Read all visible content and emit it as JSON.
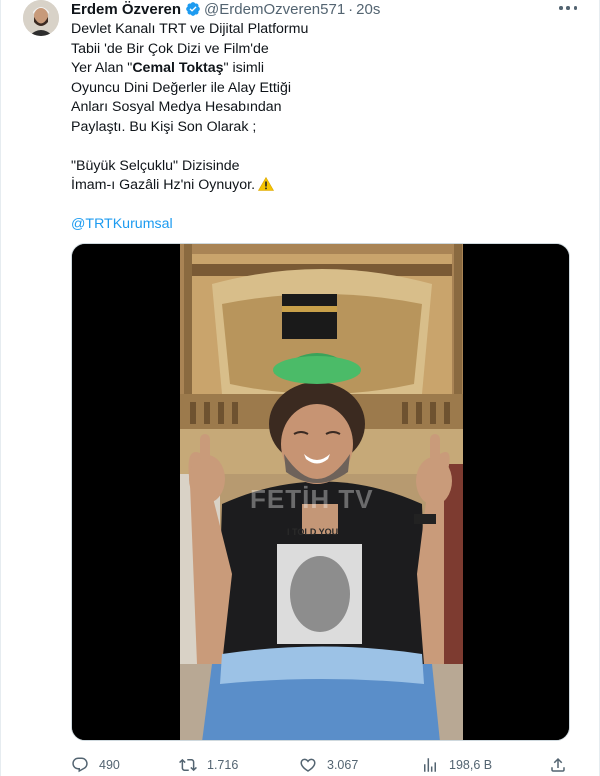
{
  "tweet": {
    "author_name": "Erdem Özveren",
    "handle": "@ErdemOzveren571",
    "separator": "·",
    "time": "20s",
    "text_lines": [
      "Devlet Kanalı TRT ve Dijital Platformu",
      "Tabii 'de Bir Çok Dizi ve Film'de",
      "Oyuncu Dini Değerler ile Alay Ettiği",
      "Anları Sosyal Medya Hesabından",
      "Paylaştı.  Bu Kişi Son Olarak ;",
      "\"Büyük Selçuklu\" Dizisinde",
      "İmam-ı Gazâli Hz'ni Oynuyor."
    ],
    "line3_prefix": "Yer Alan \"",
    "line3_bold": "Cemal Toktaş",
    "line3_suffix": "\" isimli",
    "mention": "@TRTKurumsal",
    "media_watermark": "FETİH TV",
    "shirt_text": "I TOLD YOU"
  },
  "actions": {
    "reply_count": "490",
    "retweet_count": "1.716",
    "like_count": "3.067",
    "views_count": "198,6 B"
  },
  "colors": {
    "accent": "#1d9bf0",
    "text": "#0f1419",
    "muted": "#536471",
    "warning": "#f5c400"
  },
  "icons": [
    "verified-badge-icon",
    "more-icon",
    "warning-icon",
    "reply-icon",
    "retweet-icon",
    "like-icon",
    "views-icon",
    "share-icon"
  ]
}
